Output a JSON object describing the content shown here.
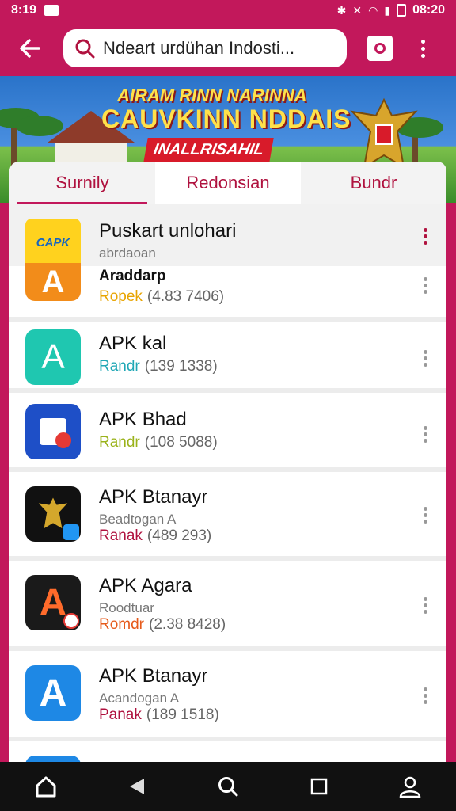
{
  "status_bar": {
    "time": "8:19",
    "clock": "08:20"
  },
  "search": {
    "value": "Ndeart urdühan Indosti..."
  },
  "banner": {
    "line1": "AIRAM RINN NARINNA",
    "line2": "CAUVKINN NDDAIS",
    "line3": "INALLRISAHIL"
  },
  "tabs": [
    {
      "label": "Surnily"
    },
    {
      "label": "Redonsian"
    },
    {
      "label": "Bundr"
    }
  ],
  "apps": [
    {
      "title": "Puskart unlohari",
      "sub": "abrdaoan",
      "tag": "",
      "tag_color": "#888888",
      "count": "",
      "icon_color": "#ffd21e",
      "icon_letter": "CAPK",
      "icon_fg": "#1565c0"
    },
    {
      "title": "Araddarp",
      "sub": "",
      "tag": "Ropek",
      "tag_color": "#e8a400",
      "count": "(4.83 7406)",
      "icon_color": "#f28c1a",
      "icon_letter": "A",
      "icon_fg": "#ffffff"
    },
    {
      "title": "APK kal",
      "sub": "",
      "tag": "Randr",
      "tag_color": "#1fa7b5",
      "count": "(139 1338)",
      "icon_color": "#1fc7b0",
      "icon_letter": "A",
      "icon_fg": "#ffffff"
    },
    {
      "title": "APK Bhad",
      "sub": "",
      "tag": "Randr",
      "tag_color": "#9ab21a",
      "count": "(108 5088)",
      "icon_color": "#1e4fc7",
      "icon_letter": "",
      "icon_fg": "#ffffff"
    },
    {
      "title": "APK Btanayr",
      "sub": "Beadtogan A",
      "tag": "Ranak",
      "tag_color": "#b0123f",
      "count": "(489 293)",
      "icon_color": "#111111",
      "icon_letter": "",
      "icon_fg": "#d4a72c"
    },
    {
      "title": "APK Agara",
      "sub": "Roodtuar",
      "tag": "Romdr",
      "tag_color": "#e65a1a",
      "count": "(2.38 8428)",
      "icon_color": "#1a1a1a",
      "icon_letter": "A",
      "icon_fg": "#ff6b2b"
    },
    {
      "title": "APK Btanayr",
      "sub": "Acandogan A",
      "tag": "Panak",
      "tag_color": "#b0123f",
      "count": "(189 1518)",
      "icon_color": "#1e88e5",
      "icon_letter": "A",
      "icon_fg": "#ffffff"
    }
  ]
}
